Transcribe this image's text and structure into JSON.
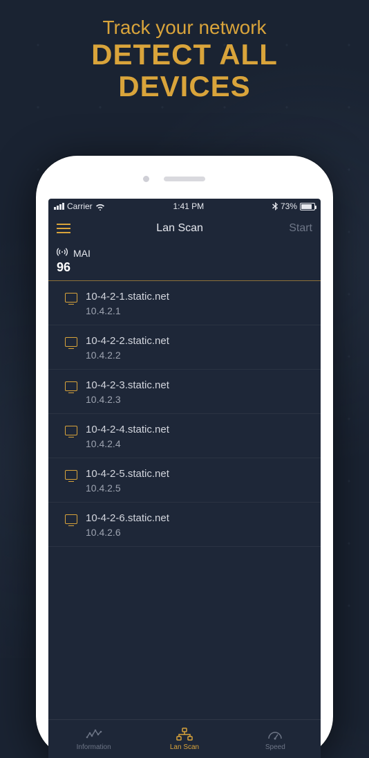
{
  "promo": {
    "subtitle": "Track your network",
    "title_line1": "DETECT ALL",
    "title_line2": "DEVICES"
  },
  "statusbar": {
    "carrier": "Carrier",
    "time": "1:41 PM",
    "battery_pct": "73%"
  },
  "navbar": {
    "title": "Lan Scan",
    "action": "Start"
  },
  "network": {
    "name": "MAI",
    "count": "96"
  },
  "devices": [
    {
      "host": "10-4-2-1.static.net",
      "ip": "10.4.2.1"
    },
    {
      "host": "10-4-2-2.static.net",
      "ip": "10.4.2.2"
    },
    {
      "host": "10-4-2-3.static.net",
      "ip": "10.4.2.3"
    },
    {
      "host": "10-4-2-4.static.net",
      "ip": "10.4.2.4"
    },
    {
      "host": "10-4-2-5.static.net",
      "ip": "10.4.2.5"
    },
    {
      "host": "10-4-2-6.static.net",
      "ip": "10.4.2.6"
    }
  ],
  "tabs": {
    "information": "Information",
    "lanscan": "Lan Scan",
    "speed": "Speed"
  }
}
